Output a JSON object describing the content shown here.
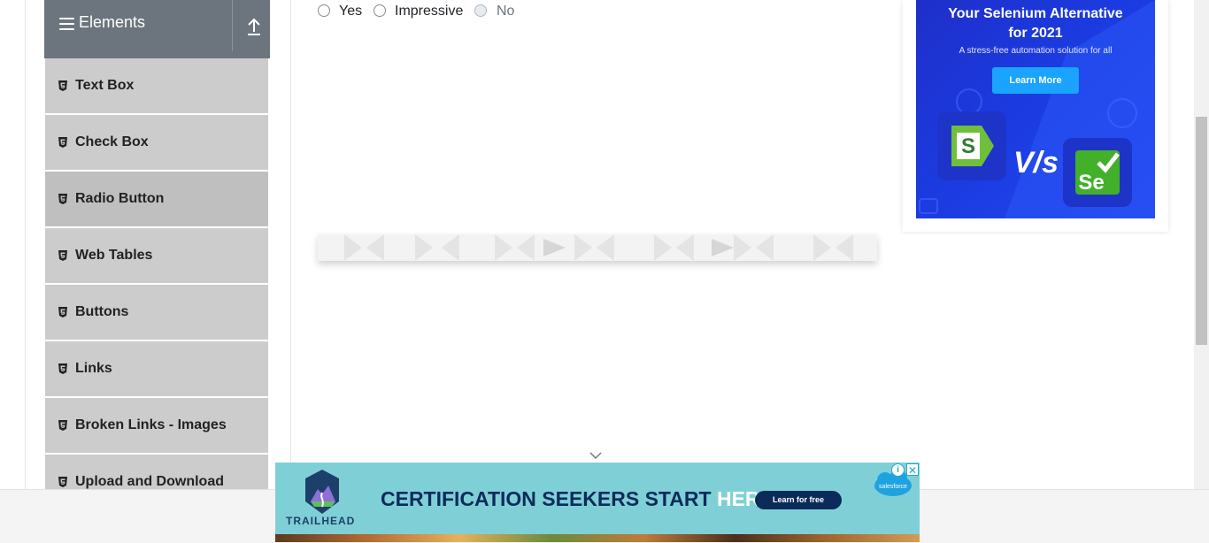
{
  "sidebar": {
    "group_title": "Elements",
    "items": [
      {
        "label": "Text Box",
        "active": false
      },
      {
        "label": "Check Box",
        "active": false
      },
      {
        "label": "Radio Button",
        "active": true
      },
      {
        "label": "Web Tables",
        "active": false
      },
      {
        "label": "Buttons",
        "active": false
      },
      {
        "label": "Links",
        "active": false
      },
      {
        "label": "Broken Links - Images",
        "active": false
      },
      {
        "label": "Upload and Download",
        "active": false
      }
    ]
  },
  "radio_group": {
    "options": [
      {
        "label": "Yes",
        "checked": false,
        "disabled": false
      },
      {
        "label": "Impressive",
        "checked": false,
        "disabled": false
      },
      {
        "label": "No",
        "checked": false,
        "disabled": true
      }
    ]
  },
  "ad_right": {
    "headline_line1": "Your Selenium Alternative",
    "headline_line2": "for 2021",
    "subtext": "A stress-free automation solution for all",
    "cta": "Learn More",
    "vs_text": "V/s",
    "logo_left": "S",
    "logo_right": "Se"
  },
  "ad_bottom": {
    "brand": "TRAILHEAD",
    "headline_main": "CERTIFICATION SEEKERS START ",
    "headline_accent": "HERE.",
    "cta": "Learn for free",
    "partner": "salesforce",
    "adchoices_icon": "i",
    "close_icon": "✕"
  },
  "colors": {
    "sidebar_header": "#6c757d",
    "menu_item": "#cccccc",
    "menu_item_active": "#bfbfbf",
    "ad_right_bg": "#1b3be0",
    "ad_bottom_bg": "#7fd0d6"
  }
}
